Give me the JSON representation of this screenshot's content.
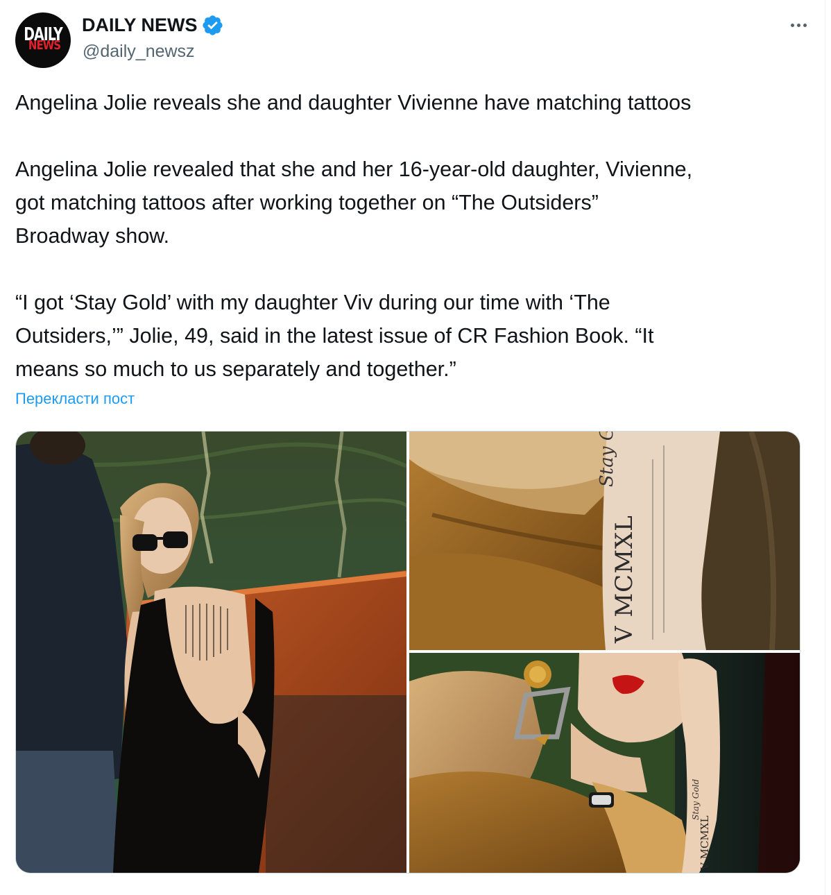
{
  "account": {
    "avatar_top": "DAILY",
    "avatar_bottom": "NEWS",
    "name": "DAILY NEWS",
    "handle": "@daily_newsz",
    "verified_icon": "verified-badge-icon",
    "more_icon": "more-options-icon"
  },
  "tweet": {
    "headline": "Angelina Jolie reveals she and daughter Vivienne have matching tattoos",
    "body_line1": "Angelina Jolie revealed that she and her 16-year-old daughter, Vivienne,",
    "body_line2": "got matching tattoos after working together on “The Outsiders”",
    "body_line3": "Broadway show.",
    "quote_line1": "“I got ‘Stay Gold’ with my daughter Viv during our time with ‘The",
    "quote_line2": "Outsiders,’” Jolie, 49, said in the latest issue of CR Fashion Book. “It",
    "quote_line3": "means so much to us separately and together.”"
  },
  "translate_label": "Перекласти пост",
  "media": {
    "tattoo_text_large": "V MCMXL",
    "tattoo_script_large": "Stay Gold",
    "tattoo_text_small": "V MCMXL",
    "tattoo_script_small": "Stay Gold"
  },
  "colors": {
    "link": "#1d9bf0",
    "text": "#0f1419",
    "secondary": "#536471",
    "verified": "#1d9bf0"
  }
}
